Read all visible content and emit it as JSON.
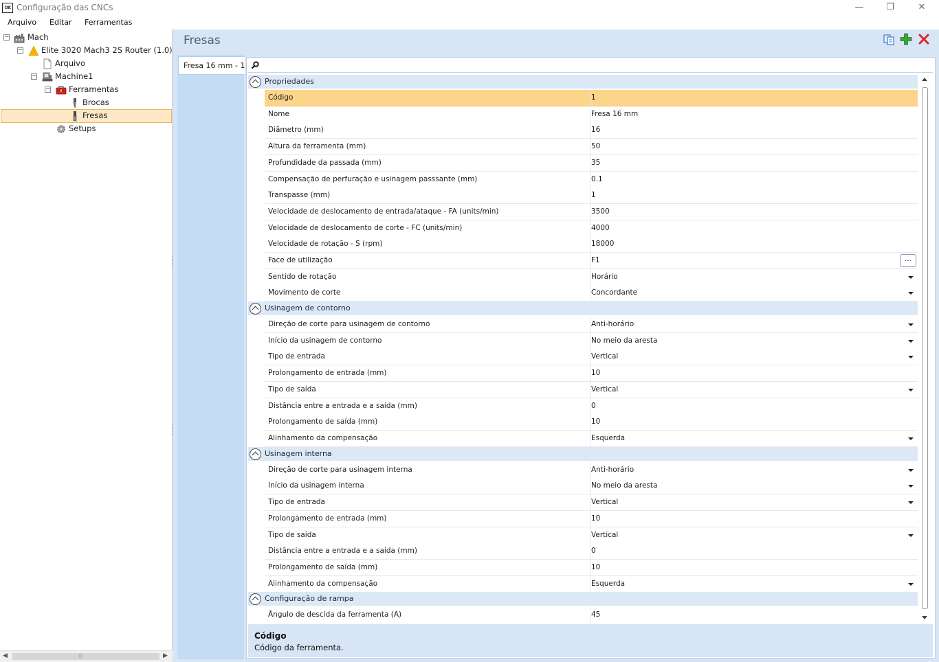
{
  "window": {
    "icon_text": "CNC",
    "title": "Configuração das CNCs",
    "controls": {
      "minimize": "—",
      "restore": "❐",
      "close": "✕"
    }
  },
  "menu": [
    "Arquivo",
    "Editar",
    "Ferramentas"
  ],
  "tree": {
    "items": [
      {
        "label": "Mach",
        "icon": "factory-icon"
      },
      {
        "label": "Elite 3020 Mach3 2S Router (1.0)",
        "icon": "warning-icon"
      },
      {
        "label": "Arquivo",
        "icon": "document-icon"
      },
      {
        "label": "Machine1",
        "icon": "machine-icon"
      },
      {
        "label": "Ferramentas",
        "icon": "toolbox-icon"
      },
      {
        "label": "Brocas",
        "icon": "drill-bit-icon"
      },
      {
        "label": "Fresas",
        "icon": "mill-bit-icon",
        "selected": true
      },
      {
        "label": "Setups",
        "icon": "gear-icon"
      }
    ],
    "expanders": {
      "collapse": "−"
    },
    "scroll": {
      "left": "◀",
      "right": "▶",
      "grip": "|||"
    }
  },
  "main": {
    "title": "Fresas",
    "buttons": {
      "copy": "copy-icon",
      "add": "add-icon",
      "delete": "delete-icon"
    },
    "tool_list": [
      "Fresa 16 mm - 1"
    ],
    "list_scroll": {
      "up": "▲",
      "down": "▼"
    }
  },
  "grid": {
    "categories": [
      {
        "label": "Propriedades",
        "rows": [
          {
            "name": "Código",
            "value": "1",
            "selected": true
          },
          {
            "name": "Nome",
            "value": "Fresa 16 mm"
          },
          {
            "name": "Diâmetro (mm)",
            "value": "16"
          },
          {
            "name": "Altura da ferramenta (mm)",
            "value": "50"
          },
          {
            "name": "Profundidade da passada (mm)",
            "value": "35"
          },
          {
            "name": "Compensação de perfuração e usinagem passsante (mm)",
            "value": "0.1"
          },
          {
            "name": "Transpasse (mm)",
            "value": "1"
          },
          {
            "name": "Velocidade de deslocamento de entrada/ataque - FA (units/min)",
            "value": "3500"
          },
          {
            "name": "Velocidade de deslocamento de corte - FC (units/min)",
            "value": "4000"
          },
          {
            "name": "Velocidade de rotação - S (rpm)",
            "value": "18000"
          },
          {
            "name": "Face de utilização",
            "value": "F1",
            "editor": "ellipsis"
          },
          {
            "name": "Sentido de rotação",
            "value": "Horário",
            "editor": "dropdown"
          },
          {
            "name": "Movimento de corte",
            "value": "Concordante",
            "editor": "dropdown"
          }
        ]
      },
      {
        "label": "Usinagem de contorno",
        "rows": [
          {
            "name": "Direção de corte para usinagem de contorno",
            "value": "Anti-horário",
            "editor": "dropdown"
          },
          {
            "name": "Início da usinagem de contorno",
            "value": "No meio da aresta",
            "editor": "dropdown"
          },
          {
            "name": "Tipo de entrada",
            "value": "Vertical",
            "editor": "dropdown"
          },
          {
            "name": "Prolongamento de entrada (mm)",
            "value": "10"
          },
          {
            "name": "Tipo de saída",
            "value": "Vertical",
            "editor": "dropdown"
          },
          {
            "name": "Distância entre a entrada e a saída (mm)",
            "value": "0"
          },
          {
            "name": "Prolongamento de saída (mm)",
            "value": "10"
          },
          {
            "name": "Alinhamento da compensação",
            "value": "Esquerda",
            "editor": "dropdown"
          }
        ]
      },
      {
        "label": "Usinagem interna",
        "rows": [
          {
            "name": "Direção de corte para usinagem interna",
            "value": "Anti-horário",
            "editor": "dropdown"
          },
          {
            "name": "Início da usinagem interna",
            "value": "No meio da aresta",
            "editor": "dropdown"
          },
          {
            "name": "Tipo de entrada",
            "value": "Vertical",
            "editor": "dropdown"
          },
          {
            "name": "Prolongamento de entrada (mm)",
            "value": "10"
          },
          {
            "name": "Tipo de saída",
            "value": "Vertical",
            "editor": "dropdown"
          },
          {
            "name": "Distância entre a entrada e a saída (mm)",
            "value": "0"
          },
          {
            "name": "Prolongamento de saída (mm)",
            "value": "10"
          },
          {
            "name": "Alinhamento da compensação",
            "value": "Esquerda",
            "editor": "dropdown"
          }
        ]
      },
      {
        "label": "Configuração de rampa",
        "rows": [
          {
            "name": "Ângulo de descida da ferramenta (A)",
            "value": "45"
          }
        ]
      }
    ],
    "ellipsis_label": "...",
    "description": {
      "title": "Código",
      "text": "Código da ferramenta."
    }
  },
  "colors": {
    "panel_bg": "#d7e5f5",
    "selection": "#fcd48a",
    "tree_selection": "#fde7c4",
    "add_green": "#3aa53a",
    "delete_red": "#d8262c"
  }
}
